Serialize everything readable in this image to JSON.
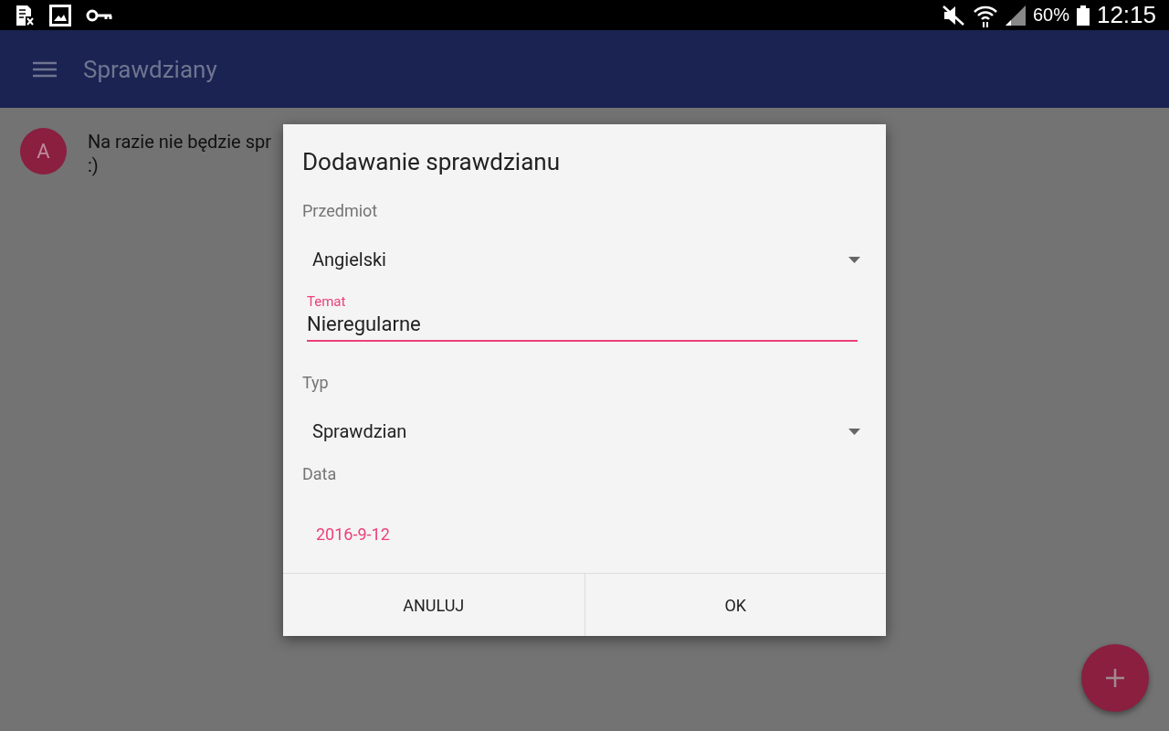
{
  "status_bar": {
    "battery": "60%",
    "time": "12:15"
  },
  "app_bar": {
    "title": "Sprawdziany"
  },
  "list": [
    {
      "avatar": "A",
      "text": "Na razie nie będzie spr",
      "text_line_2": ":)"
    }
  ],
  "dialog": {
    "title": "Dodawanie sprawdzianu",
    "fields": [
      {
        "kind": "spinner",
        "label": "Przedmiot",
        "value": "Angielski"
      },
      {
        "kind": "text",
        "label": "Temat",
        "value": "Nieregularne",
        "focused": true
      },
      {
        "kind": "spinner",
        "label": "Typ",
        "value": "Sprawdzian"
      },
      {
        "kind": "date",
        "label": "Data",
        "value": "2016-9-12"
      }
    ],
    "buttons": [
      "ANULUJ",
      "OK"
    ]
  }
}
